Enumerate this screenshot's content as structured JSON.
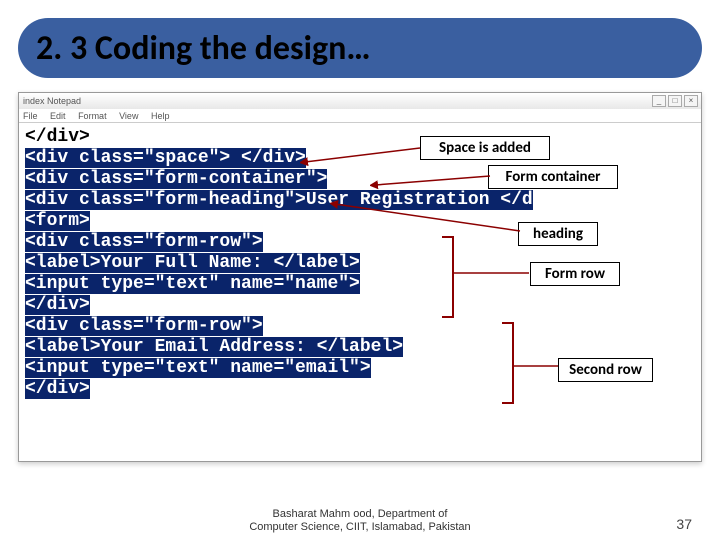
{
  "slide": {
    "title": "2. 3 Coding the design…"
  },
  "editor": {
    "window_title": "index  Notepad",
    "menu": {
      "file": "File",
      "edit": "Edit",
      "format": "Format",
      "view": "View",
      "help": "Help"
    },
    "win": {
      "min": "_",
      "max": "□",
      "close": "×"
    }
  },
  "code": {
    "l1": "</div>",
    "l2": "<div class=\"space\"> </div>",
    "l3a": "<div class=\"form-container\">",
    "l3b": "<div class=\"form‐container\">",
    "l4a": "<div class=\"form-heading\">",
    "l4b": "User",
    "l4c": " Registration </d",
    "l5": "<form>",
    "l6": "<div class=\"form-row\">",
    "l7": "<label>Your Full Name: </label>",
    "l8": "<input type=\"text\" name=\"name\">",
    "l9": "</div>",
    "l10": "<div class=\"form‐row\">",
    "l11": "<label>Your Email Address: </label>",
    "l12": "<input type=\"text\" name=\"email\">",
    "l13": "</div>"
  },
  "callouts": {
    "space": "Space is added",
    "container": "Form container",
    "heading": "heading",
    "row1": "Form row",
    "row2": "Second row"
  },
  "footer": {
    "line1": "Basharat Mahm ood, Department of",
    "line2": "Computer Science, CIIT, Islamabad, Pakistan",
    "page": "37"
  }
}
